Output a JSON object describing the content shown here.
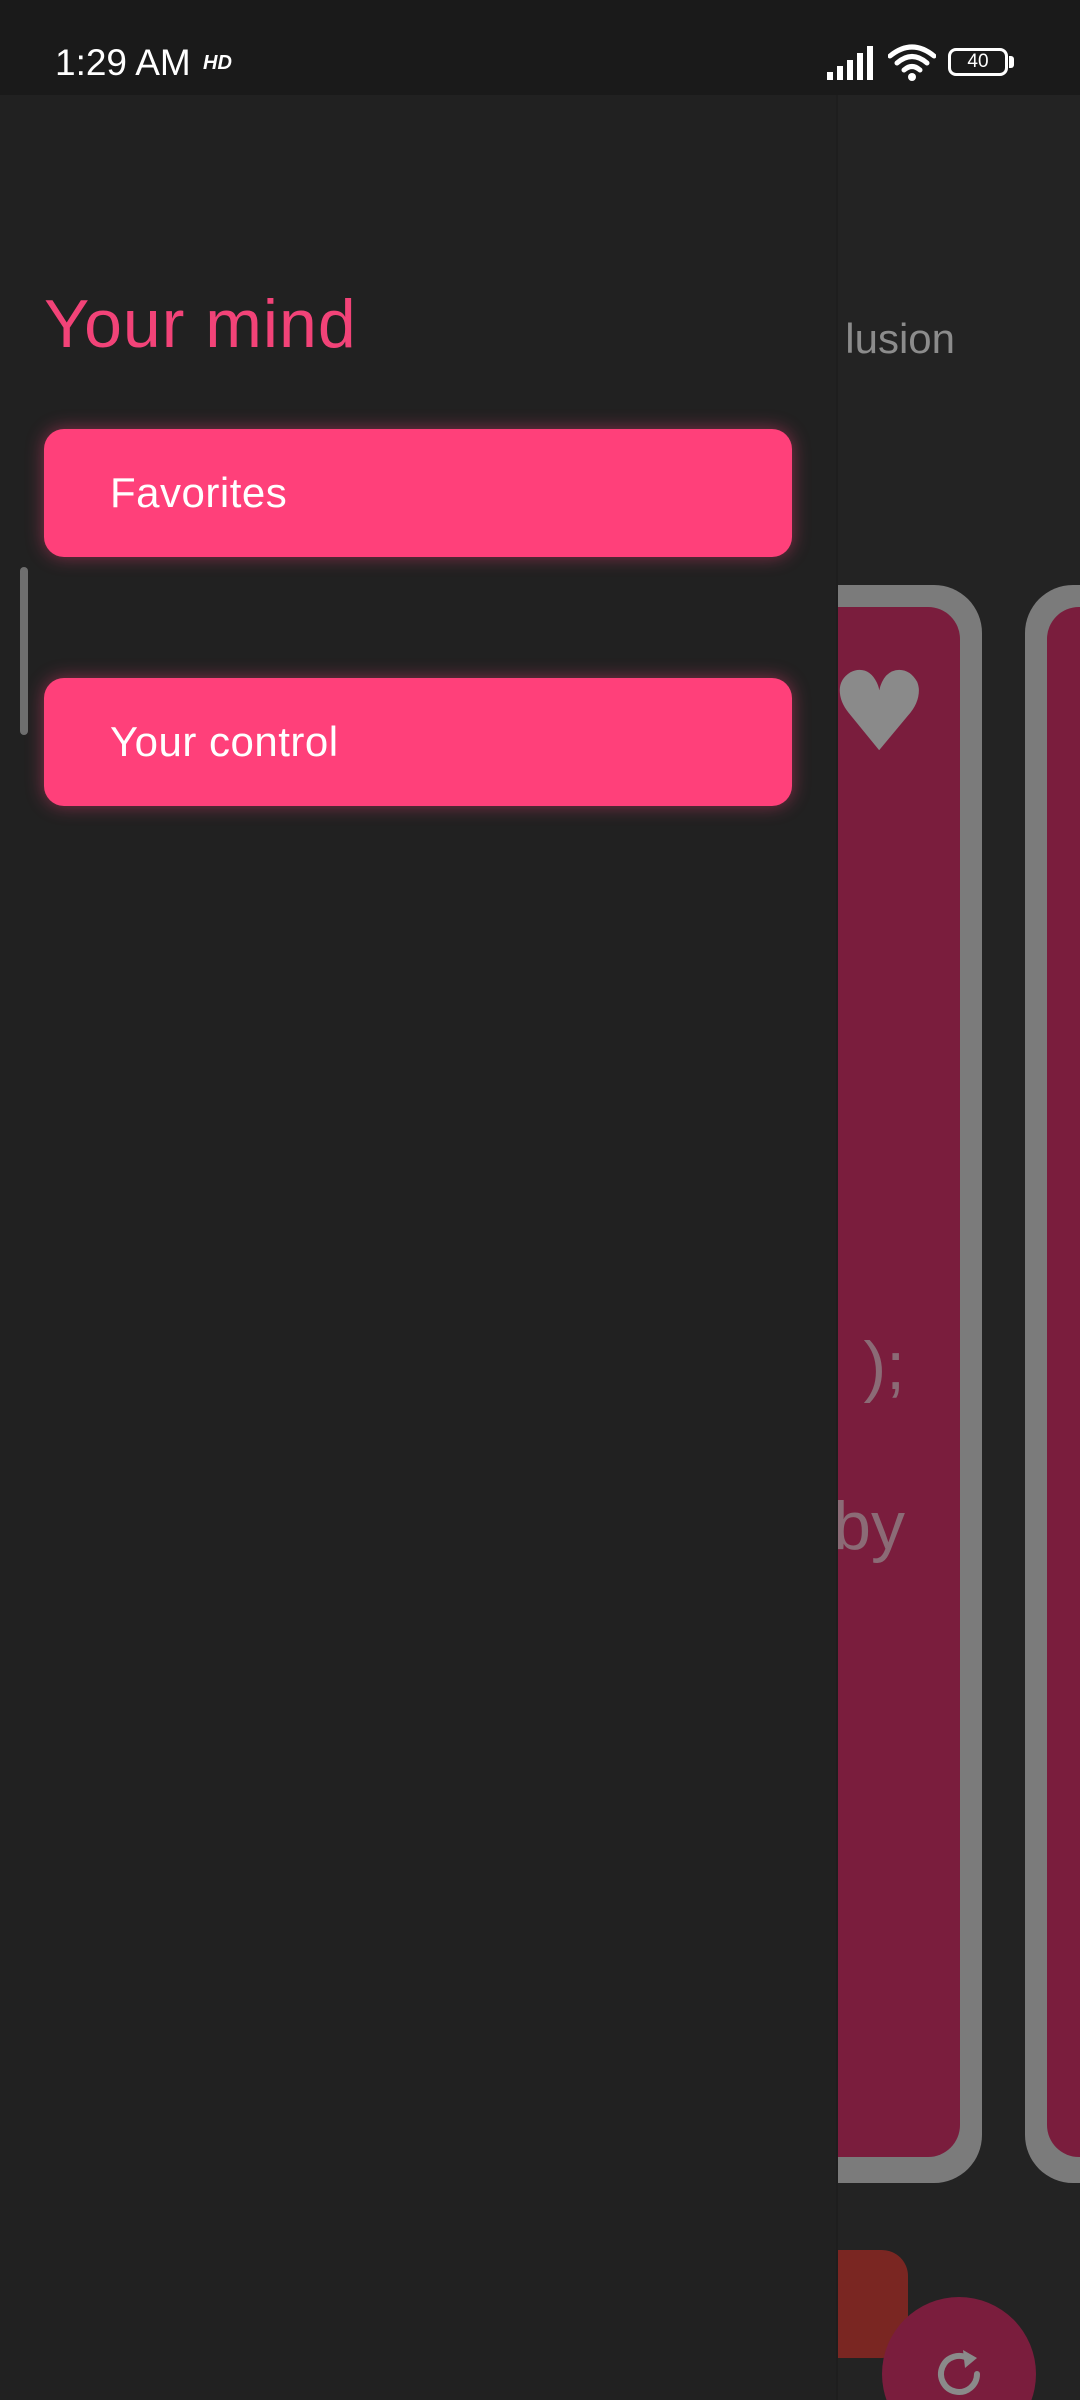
{
  "status_bar": {
    "time": "1:29 AM",
    "hd_badge": "HD",
    "battery_level": "40"
  },
  "background": {
    "title_fragment": "lusion",
    "card_text_1": ");",
    "card_text_2": "by",
    "heart_icon": "heart-icon",
    "refresh_icon": "refresh-icon"
  },
  "drawer": {
    "title": "Your mind",
    "items": [
      {
        "label": "Favorites"
      },
      {
        "label": "Your control"
      }
    ]
  },
  "colors": {
    "accent": "#ff407a",
    "title_accent": "#f24378",
    "drawer_bg": "#212121",
    "card_bg": "#7a1d3d"
  }
}
